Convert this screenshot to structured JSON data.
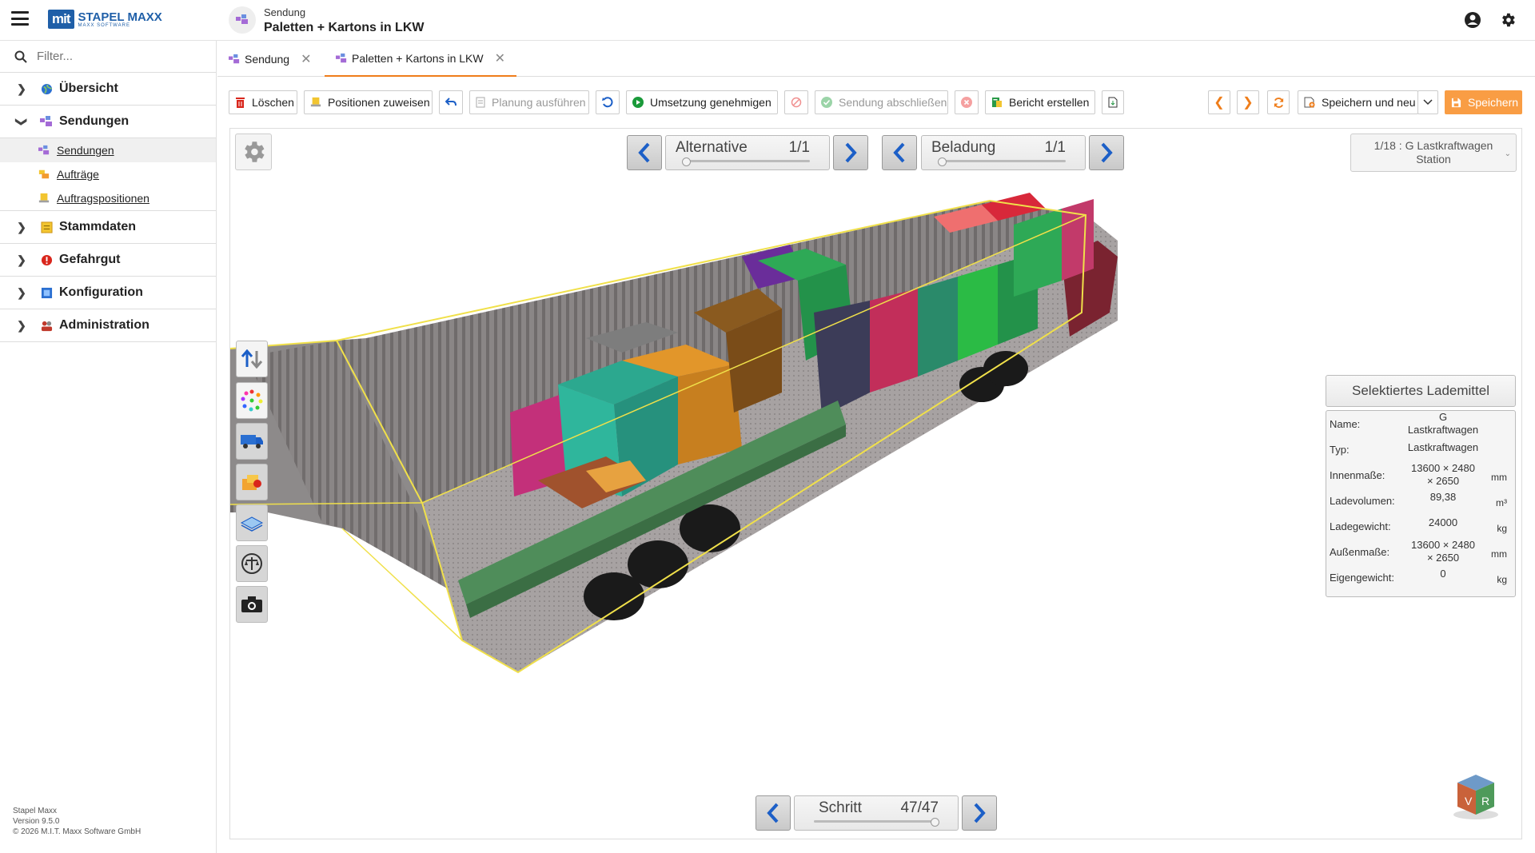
{
  "app": {
    "logo_box": "mit",
    "logo_name": "STAPEL MAXX",
    "logo_sub": "MAXX SOFTWARE",
    "breadcrumb_sub": "Sendung",
    "breadcrumb_title": "Paletten + Kartons in LKW"
  },
  "sidebar": {
    "filter_placeholder": "Filter...",
    "items": [
      {
        "label": "Übersicht"
      },
      {
        "label": "Sendungen"
      },
      {
        "label": "Stammdaten"
      },
      {
        "label": "Gefahrgut"
      },
      {
        "label": "Konfiguration"
      },
      {
        "label": "Administration"
      }
    ],
    "subitems": [
      {
        "label": "Sendungen"
      },
      {
        "label": "Aufträge"
      },
      {
        "label": "Auftragspositionen"
      }
    ],
    "footer": {
      "line1": "Stapel Maxx",
      "line2": "Version 9.5.0",
      "line3": "© 2026 M.I.T. Maxx Software GmbH"
    }
  },
  "tabs": [
    {
      "label": "Sendung"
    },
    {
      "label": "Paletten + Kartons in LKW"
    }
  ],
  "toolbar": {
    "delete": "Löschen",
    "assign": "Positionen zuweisen",
    "plan": "Planung ausführen",
    "approve": "Umsetzung genehmigen",
    "close": "Sendung abschließen",
    "report": "Bericht erstellen",
    "save_new": "Speichern und neu",
    "save": "Speichern"
  },
  "viewer": {
    "alternative": {
      "label": "Alternative",
      "value": "1/1"
    },
    "loading": {
      "label": "Beladung",
      "value": "1/1"
    },
    "step": {
      "label": "Schritt",
      "value": "47/47"
    },
    "vehicle_select": {
      "line1": "1/18 : G Lastkraftwagen",
      "line2": "Station"
    },
    "panel": {
      "title": "Selektiertes Lademittel",
      "rows": [
        {
          "key": "Name:",
          "value_l1": "G",
          "value_l2": "Lastkraftwagen",
          "unit": ""
        },
        {
          "key": "Typ:",
          "value_l1": "Lastkraftwagen",
          "value_l2": "",
          "unit": ""
        },
        {
          "key": "Innenmaße:",
          "value_l1": "13600 × 2480",
          "value_l2": "× 2650",
          "unit": "mm"
        },
        {
          "key": "Ladevolumen:",
          "value_l1": "89,38",
          "value_l2": "",
          "unit": "m³"
        },
        {
          "key": "Ladegewicht:",
          "value_l1": "24000",
          "value_l2": "",
          "unit": "kg"
        },
        {
          "key": "Außenmaße:",
          "value_l1": "13600 × 2480",
          "value_l2": "× 2650",
          "unit": "mm"
        },
        {
          "key": "Eigengewicht:",
          "value_l1": "0",
          "value_l2": "",
          "unit": "kg"
        }
      ]
    }
  },
  "colors": {
    "accent": "#ef7d1a",
    "save": "#f99d44",
    "brand": "#1f5fa8",
    "arrow_blue": "#1c5fc7"
  }
}
